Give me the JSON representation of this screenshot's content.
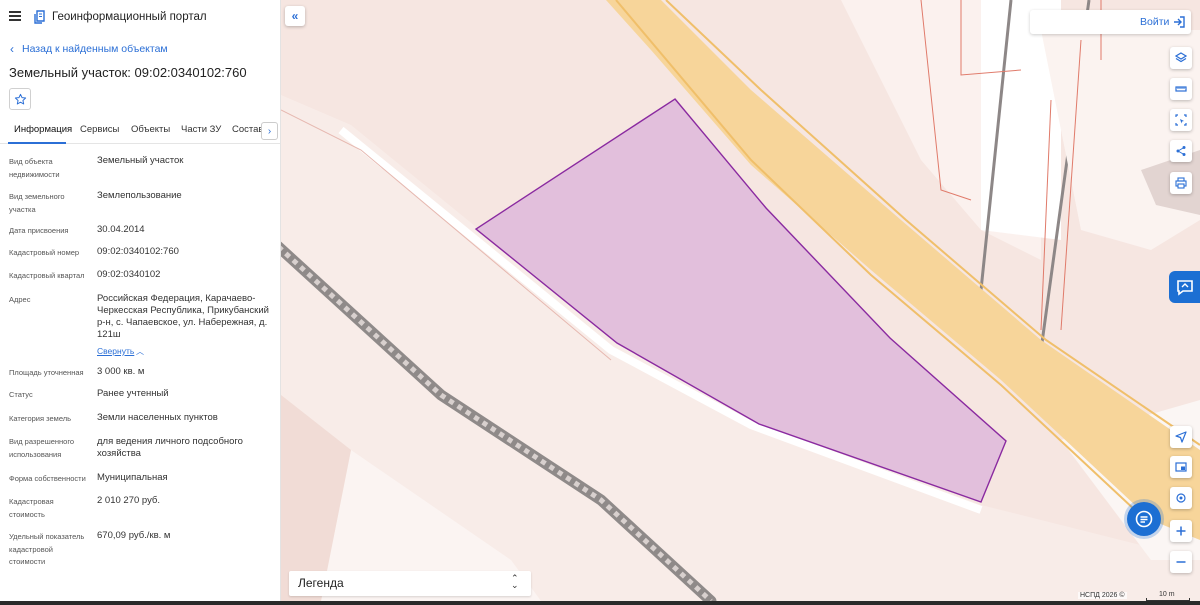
{
  "header": {
    "portal_title": "Геоинформационный портал",
    "menu_icon": "hamburger-icon",
    "logo_icon": "portal-logo-icon"
  },
  "nav": {
    "back_label": "Назад к найденным объектам"
  },
  "parcel": {
    "title": "Земельный участок: 09:02:0340102:760"
  },
  "tabs": [
    {
      "label": "Информация",
      "active": true
    },
    {
      "label": "Сервисы",
      "active": false
    },
    {
      "label": "Объекты",
      "active": false
    },
    {
      "label": "Части ЗУ",
      "active": false
    },
    {
      "label": "Состав",
      "active": false
    }
  ],
  "details": [
    {
      "label": "Вид объекта недвижимости",
      "value": "Земельный участок"
    },
    {
      "label": "Вид земельного участка",
      "value": "Землепользование"
    },
    {
      "label": "Дата присвоения",
      "value": "30.04.2014"
    },
    {
      "label": "Кадастровый номер",
      "value": "09:02:0340102:760"
    },
    {
      "label": "Кадастровый квартал",
      "value": "09:02:0340102"
    },
    {
      "label": "Адрес",
      "value": "Российская Федерация, Карачаево-Черкесская Республика, Прикубанский р-н, с. Чапаевское, ул. Набережная, д. 121ш"
    },
    {
      "label": "Площадь уточненная",
      "value": "3 000 кв. м"
    },
    {
      "label": "Статус",
      "value": "Ранее учтенный"
    },
    {
      "label": "Категория земель",
      "value": "Земли населенных пунктов"
    },
    {
      "label": "Вид разрешенного использования",
      "value": "для ведения личного подсобного хозяйства"
    },
    {
      "label": "Форма собственности",
      "value": "Муниципальная"
    },
    {
      "label": "Кадастровая стоимость",
      "value": "2 010 270 руб."
    },
    {
      "label": "Удельный показатель кадастровой стоимости",
      "value": "670,09 руб./кв. м"
    }
  ],
  "address_toggle": "Свернуть",
  "map": {
    "login_label": "Войти",
    "legend_label": "Легенда",
    "attribution": "НСПД 2026 ©",
    "scale_label": "10 m",
    "parcel_fill": "#e2bfdc",
    "parcel_stroke": "#8a2aa0",
    "road_fill": "#f7d59a",
    "accent": "#1c6fd3",
    "tools": [
      "layers-icon",
      "ruler-icon",
      "select-area-icon",
      "share-icon",
      "print-icon",
      "navigate-icon",
      "map-view-icon",
      "locate-icon",
      "zoom-in-icon",
      "zoom-out-icon"
    ]
  }
}
